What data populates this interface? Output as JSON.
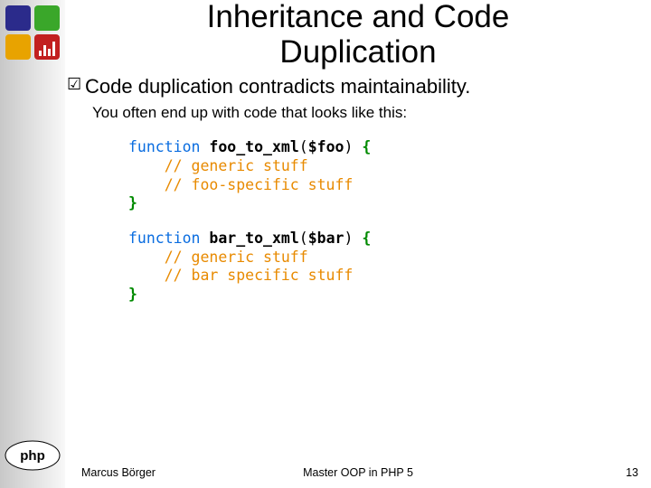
{
  "title_l1": "Inheritance and Code",
  "title_l2": "Duplication",
  "bullet": "Code duplication contradicts maintainability.",
  "subtext": "You often end up with code that looks like this:",
  "code1": {
    "kw": "function",
    "name": " foo_to_xml",
    "open": "(",
    "var": "$foo",
    "close": ") ",
    "brace_open": "{",
    "line_a": "    // generic stuff",
    "line_b": "    // foo-specific stuff",
    "brace_close": "}"
  },
  "code2": {
    "kw": "function",
    "name": " bar_to_xml",
    "open": "(",
    "var": "$bar",
    "close": ") ",
    "brace_open": "{",
    "line_a": "    // generic stuff",
    "line_b": "    // bar specific stuff",
    "brace_close": "}"
  },
  "footer": {
    "left": "Marcus Börger",
    "mid": "Master OOP in PHP 5",
    "right": "13"
  },
  "icons": {
    "check": "☑"
  }
}
